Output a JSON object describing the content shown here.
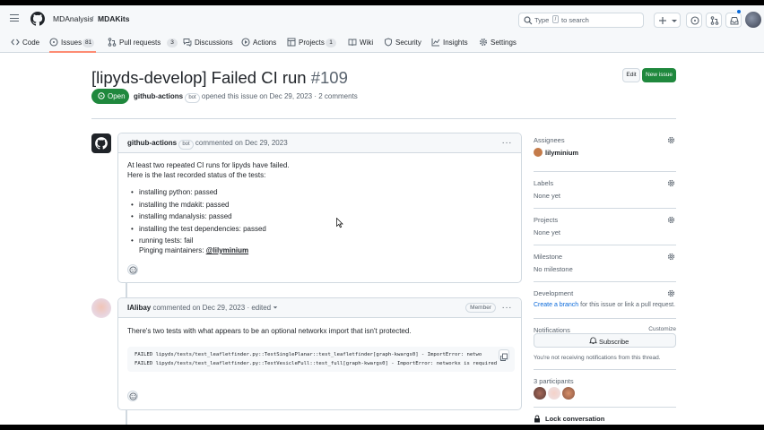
{
  "header": {
    "org": "MDAnalysis",
    "separator": "/",
    "repo": "MDAKits",
    "search_prefix": "Type",
    "search_key": "/",
    "search_suffix": "to search"
  },
  "nav": {
    "tabs": [
      {
        "label": "Code",
        "icon": "code-icon"
      },
      {
        "label": "Issues",
        "icon": "issue-icon",
        "count": "81"
      },
      {
        "label": "Pull requests",
        "icon": "pull-request-icon",
        "count": "3"
      },
      {
        "label": "Discussions",
        "icon": "discussion-icon"
      },
      {
        "label": "Actions",
        "icon": "play-icon"
      },
      {
        "label": "Projects",
        "icon": "table-icon",
        "count": "1"
      },
      {
        "label": "Wiki",
        "icon": "book-icon"
      },
      {
        "label": "Security",
        "icon": "shield-icon"
      },
      {
        "label": "Insights",
        "icon": "graph-icon"
      },
      {
        "label": "Settings",
        "icon": "gear-icon"
      }
    ]
  },
  "issue": {
    "title": "[lipyds-develop] Failed CI run",
    "number": "#109",
    "state": "Open",
    "author": "github-actions",
    "author_badge": "bot",
    "opened_text": "opened this issue on Dec 29, 2023 · 2 comments",
    "edit_label": "Edit",
    "new_issue_label": "New issue"
  },
  "comments": [
    {
      "author": "github-actions",
      "badge": "bot",
      "meta": "commented on Dec 29, 2023",
      "menu": "···",
      "line1": "At least two repeated CI runs for lipyds have failed.",
      "line2": "Here is the last recorded status of the tests:",
      "items": [
        "installing python: passed",
        "installing the mdakit: passed",
        "installing mdanalysis: passed",
        "installing the test dependencies: passed",
        "running tests: fail"
      ],
      "ping_prefix": "Pinging maintainers:",
      "ping_user": "@lilyminium"
    },
    {
      "author": "IAlibay",
      "meta": "commented on Dec 29, 2023",
      "edited": "· edited",
      "role": "Member",
      "menu": "···",
      "text": "There's two tests with what appears to be an optional networkx import that isn't protected.",
      "code1": "FAILED lipyds/tests/test_leafletfinder.py::TestSinglePlanar::test_leafletfinder[graph-kwargs0] - ImportError: netwo",
      "code2": "FAILED lipyds/tests/test_leafletfinder.py::TestVesicleFull::test_full[graph-kwargs0] - ImportError: networkx is required"
    }
  ],
  "sidebar": {
    "assignees_label": "Assignees",
    "assignee": "lilyminium",
    "labels_label": "Labels",
    "labels_value": "None yet",
    "projects_label": "Projects",
    "projects_value": "None yet",
    "milestone_label": "Milestone",
    "milestone_value": "No milestone",
    "development_label": "Development",
    "dev_link": "Create a branch",
    "dev_text": "for this issue or link a pull request.",
    "notifications_label": "Notifications",
    "customize": "Customize",
    "subscribe_label": "Subscribe",
    "notif_text": "You're not receiving notifications from this thread.",
    "participants_label": "3 participants",
    "lock_label": "Lock conversation"
  },
  "colors": {
    "open_green": "#1f883d",
    "link_blue": "#0969da",
    "tab_underline": "#fd8c73"
  }
}
